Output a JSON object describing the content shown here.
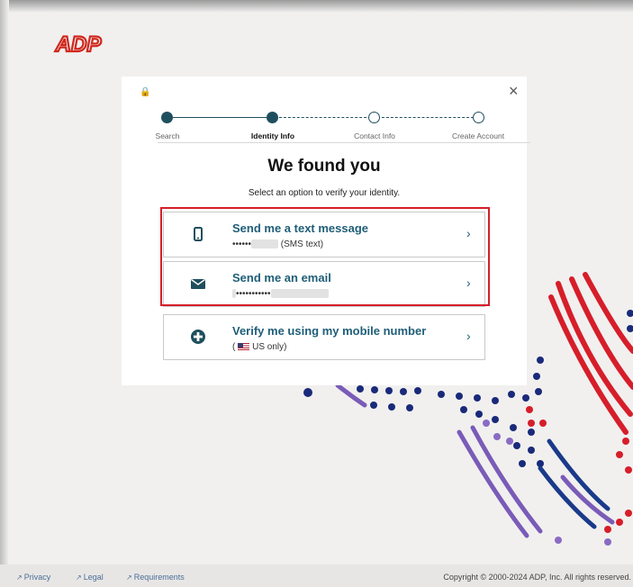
{
  "brand": {
    "logo_text": "ADP",
    "color": "#d0271d"
  },
  "modal": {
    "lock_icon": "lock-icon",
    "close_label": "×",
    "steps": [
      {
        "label": "Search",
        "state": "complete"
      },
      {
        "label": "Identity Info",
        "state": "current"
      },
      {
        "label": "Contact Info",
        "state": "pending"
      },
      {
        "label": "Create Account",
        "state": "pending"
      }
    ],
    "title": "We found you",
    "subtitle": "Select an option to verify your identity.",
    "options": [
      {
        "icon": "phone-icon",
        "title": "Send me a text message",
        "detail_mask": "••••••",
        "detail_suffix": "(SMS text)",
        "chevron": "›"
      },
      {
        "icon": "envelope-icon",
        "title": "Send me an email",
        "detail_mask": "•••••••••••",
        "chevron": "›"
      },
      {
        "icon": "plus-circle-icon",
        "title": "Verify me using my mobile number",
        "detail_prefix": "(",
        "detail_text": "US only)",
        "chevron": "›"
      }
    ]
  },
  "footer": {
    "links": [
      "Privacy",
      "Legal",
      "Requirements"
    ],
    "copyright": "Copyright © 2000-2024 ADP, Inc. All rights reserved."
  },
  "colors": {
    "accent": "#1f5e78",
    "highlight_border": "#d61e2a",
    "stepper": "#1f4f5e"
  }
}
